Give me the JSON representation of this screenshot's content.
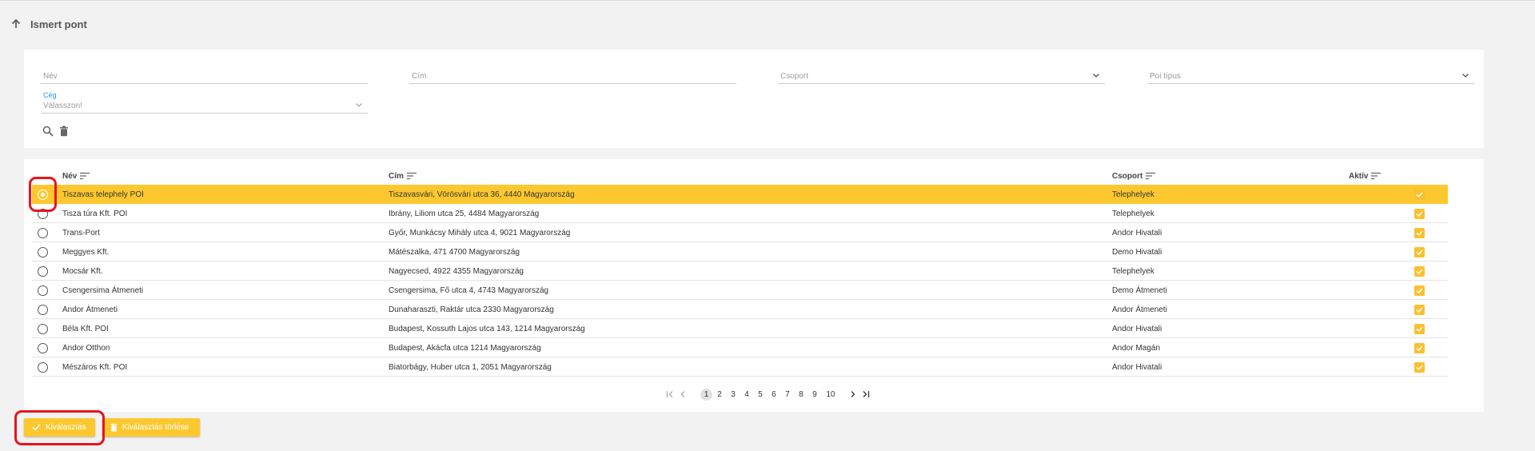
{
  "header": {
    "title": "Ismert pont"
  },
  "filters": {
    "nev_placeholder": "Név",
    "cim_placeholder": "Cím",
    "csoport_placeholder": "Csoport",
    "poi_tipus_placeholder": "Poi típus",
    "ceg_label": "Cég",
    "ceg_value": "Válasszon!"
  },
  "table": {
    "columns": {
      "nev": "Név",
      "cim": "Cím",
      "csoport": "Csoport",
      "aktiv": "Aktív"
    },
    "rows": [
      {
        "nev": "Tiszavas telephely POI",
        "cim": "Tiszavasvári, Vörösvári utca 36, 4440 Magyarország",
        "csoport": "Telephelyek",
        "aktiv": true,
        "selected": true
      },
      {
        "nev": "Tisza túra Kft. POI",
        "cim": "Ibrány, Liliom utca 25, 4484 Magyarország",
        "csoport": "Telephelyek",
        "aktiv": true,
        "selected": false
      },
      {
        "nev": "Trans-Port",
        "cim": "Győr, Munkácsy Mihály utca 4, 9021 Magyarország",
        "csoport": "Andor Hivatali",
        "aktiv": true,
        "selected": false
      },
      {
        "nev": "Meggyes Kft.",
        "cim": "Mátészalka, 471 4700 Magyarország",
        "csoport": "Demo Hivatali",
        "aktiv": true,
        "selected": false
      },
      {
        "nev": "Mocsár Kft.",
        "cim": "Nagyecsed, 4922 4355 Magyarország",
        "csoport": "Telephelyek",
        "aktiv": true,
        "selected": false
      },
      {
        "nev": "Csengersima Átmeneti",
        "cim": "Csengersima, Fő utca 4, 4743 Magyarország",
        "csoport": "Demo Átmeneti",
        "aktiv": true,
        "selected": false
      },
      {
        "nev": "Andor Átmeneti",
        "cim": "Dunaharaszti, Raktár utca 2330 Magyarország",
        "csoport": "Andor Átmeneti",
        "aktiv": true,
        "selected": false
      },
      {
        "nev": "Béla Kft. POI",
        "cim": "Budapest, Kossuth Lajos utca 143, 1214 Magyarország",
        "csoport": "Andor Hivatali",
        "aktiv": true,
        "selected": false
      },
      {
        "nev": "Andor Otthon",
        "cim": "Budapest, Akácfa utca 1214 Magyarország",
        "csoport": "Andor Magán",
        "aktiv": true,
        "selected": false
      },
      {
        "nev": "Mészáros Kft. POI",
        "cim": "Biatorbágy, Huber utca 1, 2051 Magyarország",
        "csoport": "Andor Hivatali",
        "aktiv": true,
        "selected": false
      }
    ]
  },
  "pagination": {
    "pages": [
      "1",
      "2",
      "3",
      "4",
      "5",
      "6",
      "7",
      "8",
      "9",
      "10"
    ],
    "current": "1"
  },
  "buttons": {
    "select_label": "Kiválasztás",
    "clear_label": "Kiválasztás törlése"
  },
  "colors": {
    "accent": "#fdc82f",
    "highlight": "#e8141d",
    "link_label": "#2196f3"
  },
  "icons": [
    "arrow-up-icon",
    "search-icon",
    "trash-icon",
    "sort-icon",
    "chevron-down-icon",
    "check-icon",
    "first-page-icon",
    "prev-page-icon",
    "next-page-icon",
    "last-page-icon"
  ]
}
